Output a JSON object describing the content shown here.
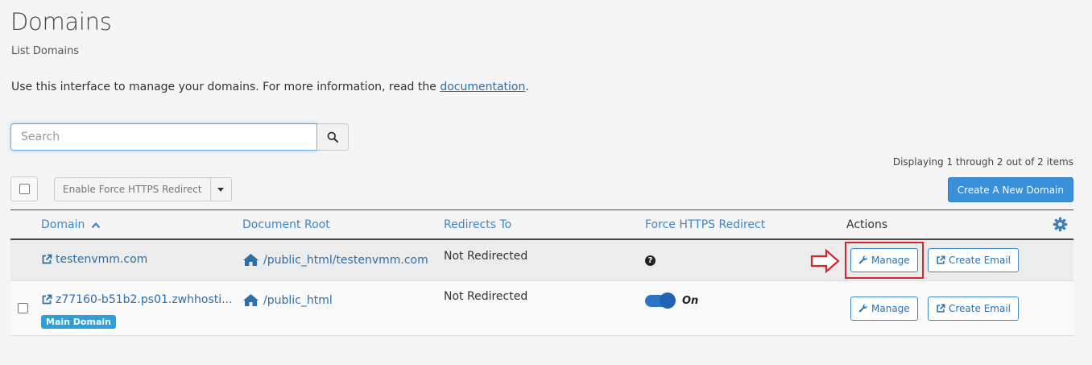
{
  "page": {
    "title": "Domains",
    "subtitle": "List Domains",
    "intro_text": "Use this interface to manage your domains. For more information, read the ",
    "intro_link": "documentation",
    "intro_end": "."
  },
  "search": {
    "placeholder": "Search",
    "value": ""
  },
  "pagination": {
    "displaying": "Displaying 1 through 2 out of 2 items"
  },
  "toolbar": {
    "bulk_action_label": "Enable Force HTTPS Redirect",
    "create_label": "Create A New Domain"
  },
  "table": {
    "headers": {
      "domain": "Domain",
      "document_root": "Document Root",
      "redirects_to": "Redirects To",
      "force_https": "Force HTTPS Redirect",
      "actions": "Actions"
    },
    "rows": [
      {
        "domain": "testenvmm.com",
        "document_root": "/public_html/testenvmm.com",
        "redirects_to": "Not Redirected",
        "badge": "",
        "manage_label": "Manage",
        "email_label": "Create Email"
      },
      {
        "domain": "z77160-b51b2.ps01.zwhhosti...",
        "document_root": "/public_html",
        "redirects_to": "Not Redirected",
        "badge": "Main Domain",
        "force_https_state": "On",
        "manage_label": "Manage",
        "email_label": "Create Email"
      }
    ]
  },
  "colors": {
    "link": "#2f6fa8",
    "primary": "#3a8fd9",
    "badge": "#2d9fd9",
    "highlight": "#d9232d"
  }
}
